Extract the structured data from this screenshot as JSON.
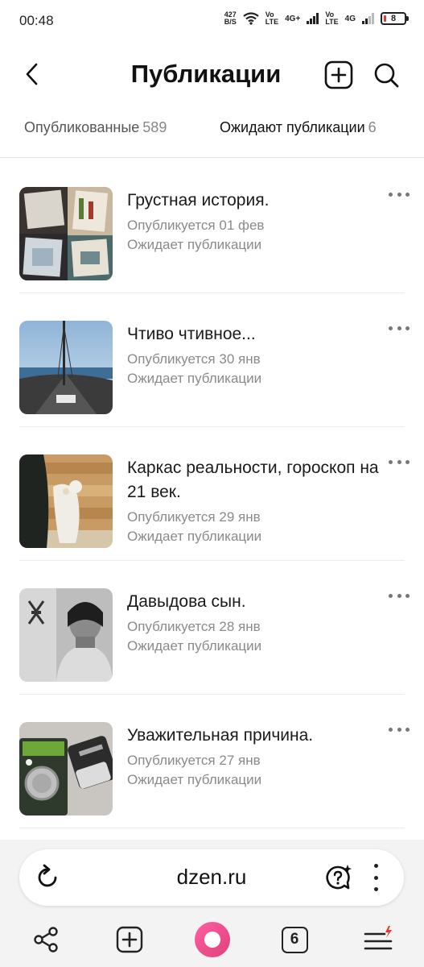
{
  "status_bar": {
    "time": "00:48",
    "net_speed_value": "427",
    "net_speed_unit": "B/S",
    "sim1_top": "Vo",
    "sim1_bottom": "LTE",
    "sim1_net": "4G+",
    "sim2_top": "Vo",
    "sim2_bottom": "LTE",
    "sim2_net": "4G",
    "battery": "8",
    "battery_color": "#e53935"
  },
  "header": {
    "title": "Публикации",
    "back_icon": "chevron-left-icon",
    "add_icon": "plus-square-icon",
    "search_icon": "search-icon"
  },
  "tabs": [
    {
      "label": "Опубликованные",
      "count": "589",
      "active": false
    },
    {
      "label": "Ожидают публикации",
      "count": "6",
      "active": true
    }
  ],
  "publications": [
    {
      "title": "Грустная история.",
      "date": "Опубликуется 01 фев",
      "status": "Ожидает публикации"
    },
    {
      "title": "Чтиво чтивное...",
      "date": "Опубликуется 30 янв",
      "status": "Ожидает публикации"
    },
    {
      "title": "Каркас реальности, гороскоп на 21 век.",
      "date": "Опубликуется 29 янв",
      "status": "Ожидает публикации"
    },
    {
      "title": "Давыдова сын.",
      "date": "Опубликуется 28 янв",
      "status": "Ожидает публикации"
    },
    {
      "title": "Уважительная причина.",
      "date": "Опубликуется 27 янв",
      "status": "Ожидает публикации"
    }
  ],
  "browser": {
    "url": "dzen.ru",
    "tabs_count": "6",
    "accent_color": "#e8447f",
    "menu_badge_color": "#e53935"
  }
}
